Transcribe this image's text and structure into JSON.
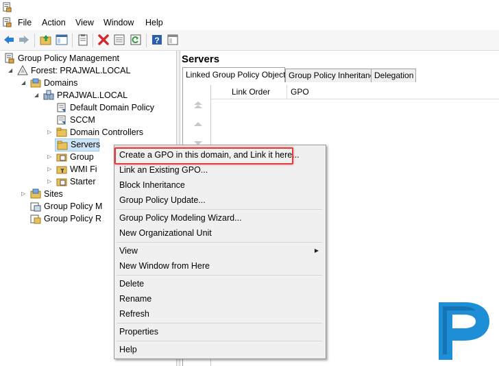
{
  "menu": {
    "file": "File",
    "action": "Action",
    "view": "View",
    "window": "Window",
    "help": "Help"
  },
  "toolbar": {
    "icons": [
      "back-icon",
      "forward-icon",
      "up-folder-icon",
      "show-hide-tree-icon",
      "clipboard-icon",
      "delete-icon",
      "properties-icon",
      "refresh-icon",
      "help-icon",
      "console-icon"
    ]
  },
  "tree": {
    "root": "Group Policy Management",
    "forest": "Forest: PRAJWAL.LOCAL",
    "domains": "Domains",
    "domain": "PRAJWAL.LOCAL",
    "default_policy": "Default Domain Policy",
    "sccm": "SCCM",
    "domain_controllers": "Domain Controllers",
    "servers": "Servers",
    "group": "Group",
    "wmi": "WMI Fi",
    "starter": "Starter",
    "sites": "Sites",
    "modeling": "Group Policy M",
    "results": "Group Policy R"
  },
  "pane": {
    "title": "Servers",
    "tabs": [
      "Linked Group Policy Objects",
      "Group Policy Inheritance",
      "Delegation"
    ],
    "columns": [
      "Link Order",
      "GPO"
    ]
  },
  "context_menu": {
    "items": [
      "Create a GPO in this domain, and Link it here...",
      "Link an Existing GPO...",
      "Block Inheritance",
      "Group Policy Update...",
      "Group Policy Modeling Wizard...",
      "New Organizational Unit",
      "View",
      "New Window from Here",
      "Delete",
      "Rename",
      "Refresh",
      "Properties",
      "Help"
    ]
  },
  "colors": {
    "highlight_border": "#e03c3c",
    "logo_blue": "#1e8fd6"
  }
}
